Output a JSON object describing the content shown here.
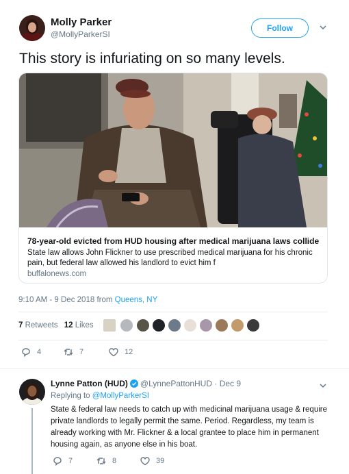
{
  "tweet": {
    "author_name": "Molly Parker",
    "author_handle": "@MollyParkerSI",
    "follow_label": "Follow",
    "text": "This story is infuriating on so many levels.",
    "card": {
      "title": "78-year-old evicted from HUD housing after medical marijuana laws collide",
      "description": "State law allows John Flickner to use prescribed medical marijuana for his chronic pain, but federal law allowed his landlord to evict him f",
      "domain": "buffalonews.com"
    },
    "timestamp": "9:10 AM - 9 Dec 2018",
    "from_label": "from",
    "location": "Queens, NY",
    "retweets_count": "7",
    "retweets_label": "Retweets",
    "likes_count": "12",
    "likes_label": "Likes",
    "replies": "4",
    "retweets": "7",
    "likes": "12"
  },
  "reply": {
    "author_name": "Lynne Patton (HUD)",
    "author_handle": "@LynnePattonHUD",
    "separator": "·",
    "date": "Dec 9",
    "replying_label": "Replying to",
    "replying_to": "@MollyParkerSI",
    "text": "State & federal law needs to catch up with medicinal marijuana usage & require private landlords to legally permit the same.  Period.  Regardless, my team is already working with Mr. Flickner & a local grantee to place him in permanent housing again, as anyone else in his boat.",
    "replies": "7",
    "retweets": "8",
    "likes": "39"
  },
  "colors": {
    "accent": "#1da1f2",
    "secondary_text": "#657786",
    "border": "#e1e8ed"
  },
  "icons": [
    "caret-down-icon",
    "reply-icon",
    "retweet-icon",
    "heart-icon",
    "verified-badge-icon"
  ]
}
